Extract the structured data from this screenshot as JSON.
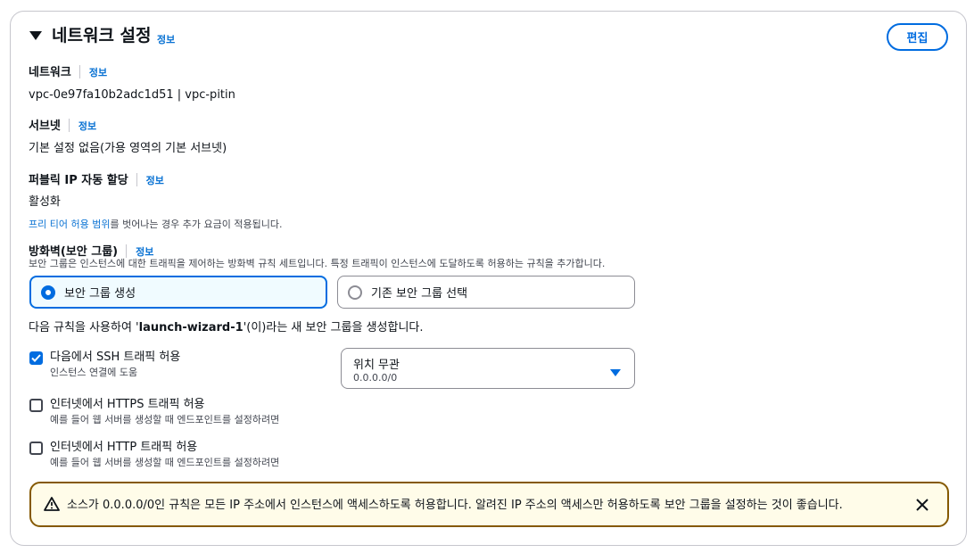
{
  "header": {
    "title": "네트워크 설정",
    "info": "정보",
    "edit_label": "편집"
  },
  "network": {
    "label": "네트워크",
    "info": "정보",
    "value": "vpc-0e97fa10b2adc1d51 | vpc-pitin"
  },
  "subnet": {
    "label": "서브넷",
    "info": "정보",
    "value": "기본 설정 없음(가용 영역의 기본 서브넷)"
  },
  "public_ip": {
    "label": "퍼블릭 IP 자동 할당",
    "info": "정보",
    "value": "활성화",
    "note_link": "프리 티어 허용 범위",
    "note_rest": "를 벗어나는 경우 추가 요금이 적용됩니다."
  },
  "firewall": {
    "label": "방화벽(보안 그룹)",
    "info": "정보",
    "description": "보안 그룹은 인스턴스에 대한 트래픽을 제어하는 방화벽 규칙 세트입니다. 특정 트래픽이 인스턴스에 도달하도록 허용하는 규칙을 추가합니다.",
    "options": [
      {
        "label": "보안 그룹 생성",
        "selected": true
      },
      {
        "label": "기존 보안 그룹 선택",
        "selected": false
      }
    ],
    "rule_prefix": "다음 규칙을 사용하여 '",
    "rule_name": "launch-wizard-1",
    "rule_suffix": "'(이)라는 새 보안 그룹을 생성합니다."
  },
  "rules": [
    {
      "label": "다음에서 SSH 트래픽 허용",
      "sub": "인스턴스 연결에 도움",
      "checked": true
    },
    {
      "label": "인터넷에서 HTTPS 트래픽 허용",
      "sub": "예를 들어 웹 서버를 생성할 때 엔드포인트를 설정하려면",
      "checked": false
    },
    {
      "label": "인터넷에서 HTTP 트래픽 허용",
      "sub": "예를 들어 웹 서버를 생성할 때 엔드포인트를 설정하려면",
      "checked": false
    }
  ],
  "ssh_source": {
    "value": "위치 무관",
    "sub": "0.0.0.0/0"
  },
  "warning": {
    "text": "소스가 0.0.0.0/0인 규칙은 모든 IP 주소에서 인스턴스에 액세스하도록 허용합니다. 알려진 IP 주소의 액세스만 허용하도록 보안 그룹을 설정하는 것이 좋습니다."
  },
  "colors": {
    "accent": "#006ce0",
    "link": "#0972d3",
    "warning_border": "#855900",
    "warning_bg": "#fffce9"
  },
  "icons": {
    "caret": "caret-down-icon",
    "warning": "warning-triangle-icon",
    "close": "close-icon",
    "check": "check-icon"
  }
}
